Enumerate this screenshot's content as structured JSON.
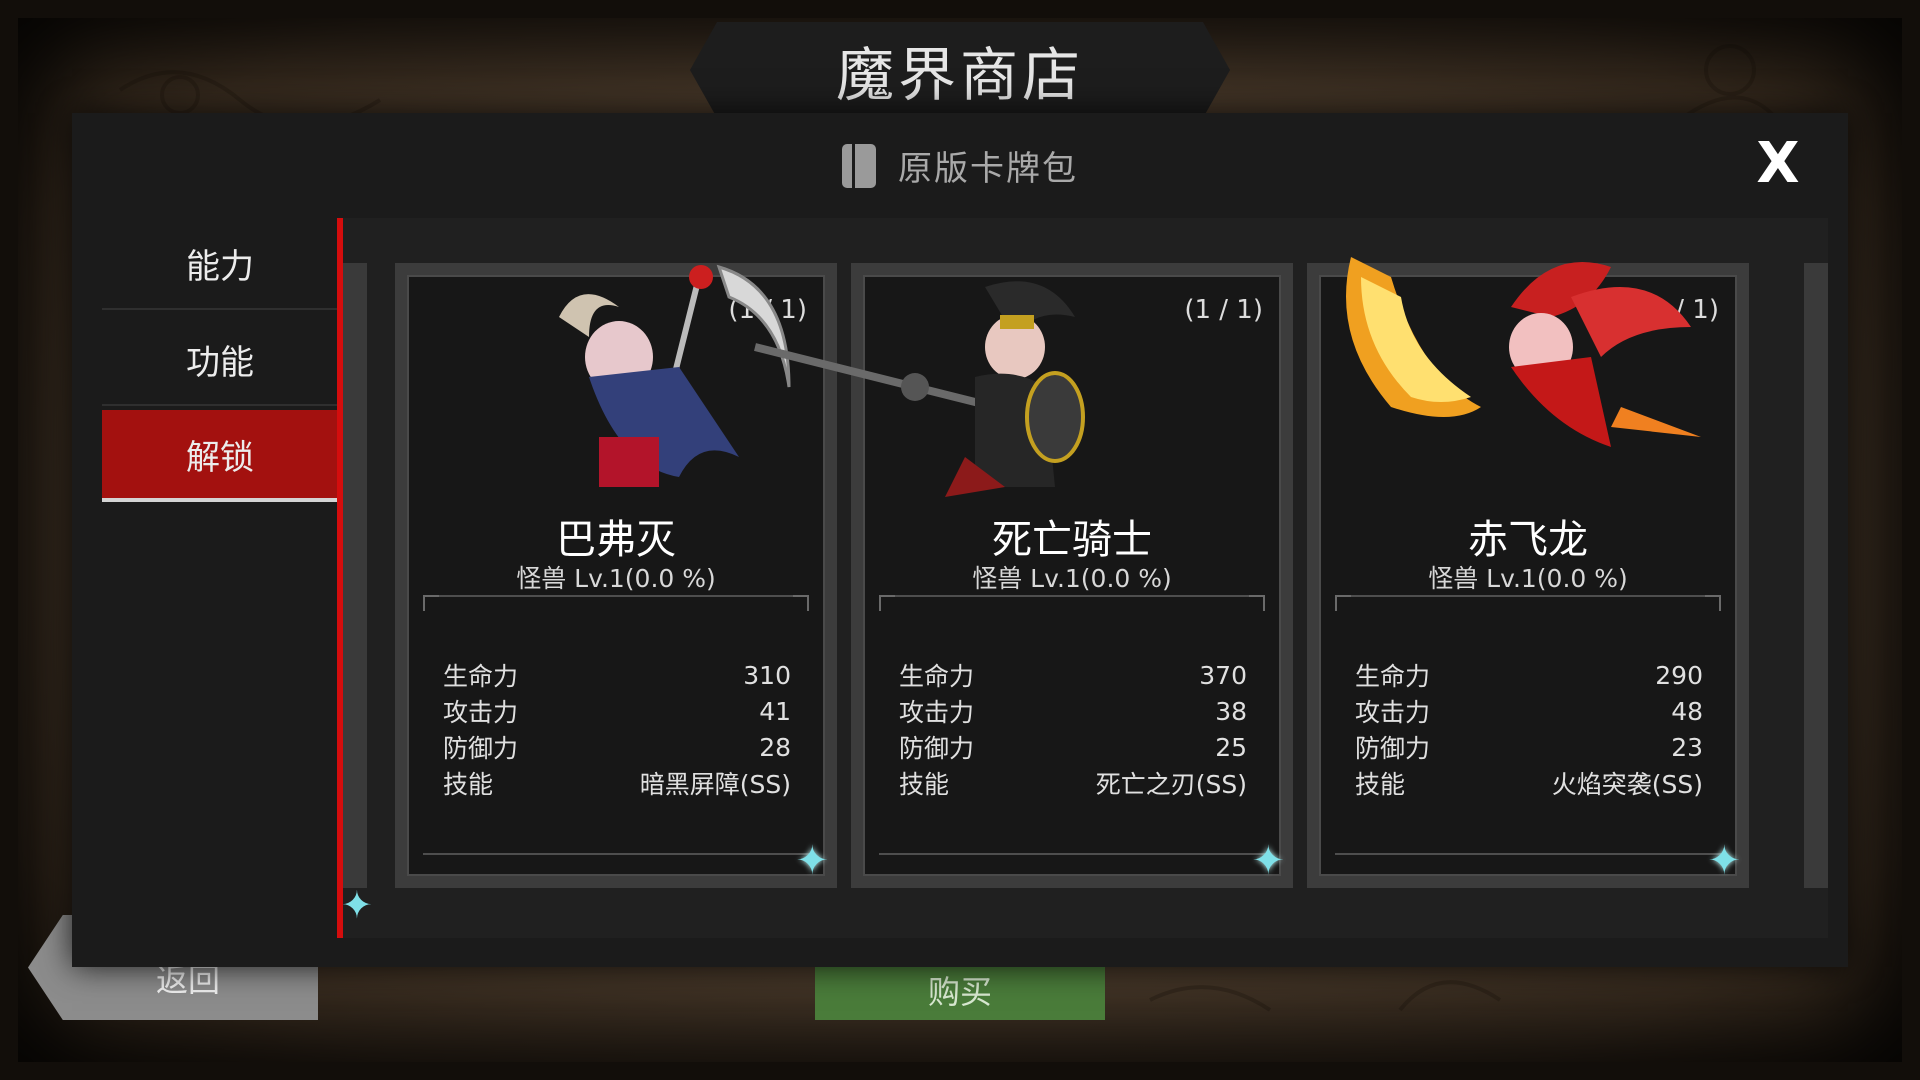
{
  "shop": {
    "title": "魔界商店",
    "pack_title": "原版卡牌包",
    "close_label": "X",
    "back_label": "返回",
    "buy_label": "购买"
  },
  "sidebar": {
    "items": [
      {
        "label": "能力",
        "active": false
      },
      {
        "label": "功能",
        "active": false
      },
      {
        "label": "解锁",
        "active": true
      }
    ]
  },
  "stat_labels": {
    "hp": "生命力",
    "atk": "攻击力",
    "def": "防御力",
    "skill": "技能"
  },
  "cards": [
    {
      "name": "巴弗灭",
      "level": "怪兽 Lv.1(0.0 %)",
      "count": "(1 / 1)",
      "hp": "310",
      "atk": "41",
      "def": "28",
      "skill": "暗黑屏障(SS)",
      "icon": "demon-scythe-sprite"
    },
    {
      "name": "死亡骑士",
      "level": "怪兽 Lv.1(0.0 %)",
      "count": "(1 / 1)",
      "hp": "370",
      "atk": "38",
      "def": "25",
      "skill": "死亡之刃(SS)",
      "icon": "death-knight-sprite"
    },
    {
      "name": "赤飞龙",
      "level": "怪兽 Lv.1(0.0 %)",
      "count": "(1 / 1)",
      "hp": "290",
      "atk": "48",
      "def": "23",
      "skill": "火焰突袭(SS)",
      "icon": "red-dragon-sprite"
    }
  ],
  "colors": {
    "accent_red": "#d40d0d",
    "active_tab": "#a3110f",
    "star": "#7fe0e8"
  }
}
